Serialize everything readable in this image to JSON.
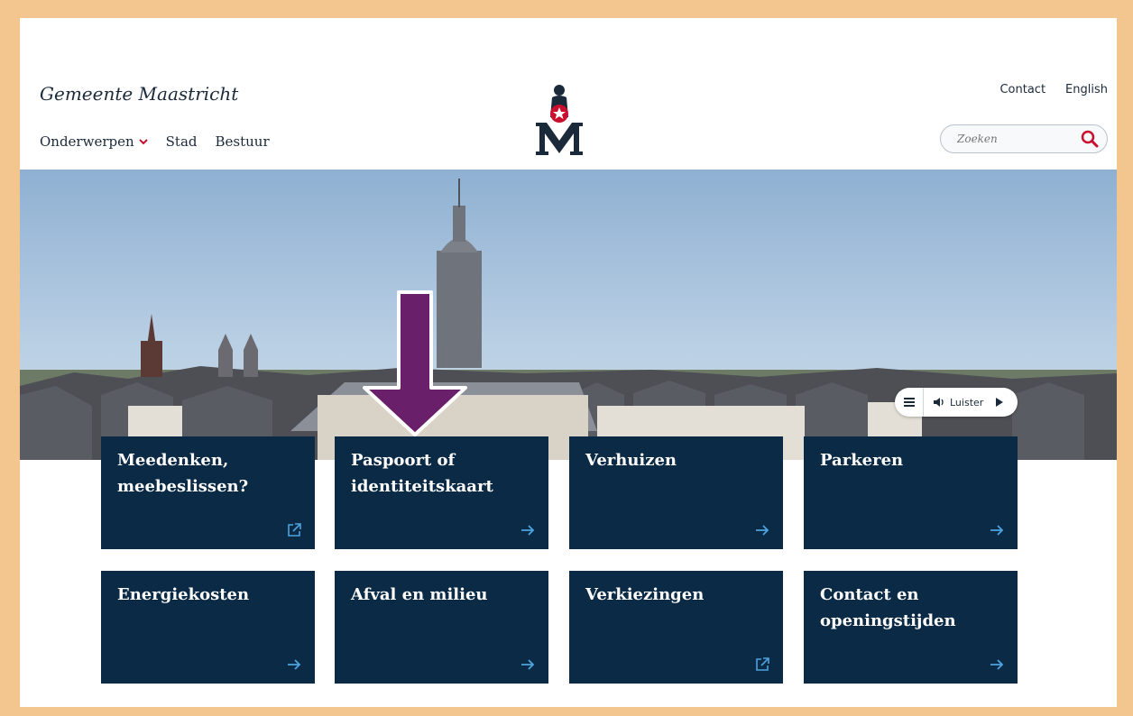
{
  "header": {
    "site_title": "Gemeente Maastricht",
    "nav": [
      {
        "label": "Onderwerpen",
        "has_dropdown": true
      },
      {
        "label": "Stad",
        "has_dropdown": false
      },
      {
        "label": "Bestuur",
        "has_dropdown": false
      }
    ],
    "top_links": [
      {
        "label": "Contact"
      },
      {
        "label": "English"
      }
    ],
    "search": {
      "placeholder": "Zoeken",
      "icon": "search-icon"
    }
  },
  "listen_widget": {
    "label": "Luister",
    "menu_icon": "hamburger-icon",
    "speaker_icon": "speaker-icon",
    "play_icon": "play-icon"
  },
  "tiles": [
    {
      "label": "Meedenken, meebeslissen?",
      "icon": "external-link-icon"
    },
    {
      "label": "Paspoort of identiteitskaart",
      "icon": "arrow-right-icon"
    },
    {
      "label": "Verhuizen",
      "icon": "arrow-right-icon"
    },
    {
      "label": "Parkeren",
      "icon": "arrow-right-icon"
    },
    {
      "label": "Energiekosten",
      "icon": "arrow-right-icon"
    },
    {
      "label": "Afval en milieu",
      "icon": "arrow-right-icon"
    },
    {
      "label": "Verkiezingen",
      "icon": "external-link-icon"
    },
    {
      "label": "Contact en openingstijden",
      "icon": "arrow-right-icon"
    }
  ],
  "colors": {
    "tile_bg": "#0b2a45",
    "tile_icon": "#4da3e0",
    "accent_red": "#c8102e",
    "annotation_arrow": "#6a1f6b",
    "frame_border": "#f3c58f"
  }
}
